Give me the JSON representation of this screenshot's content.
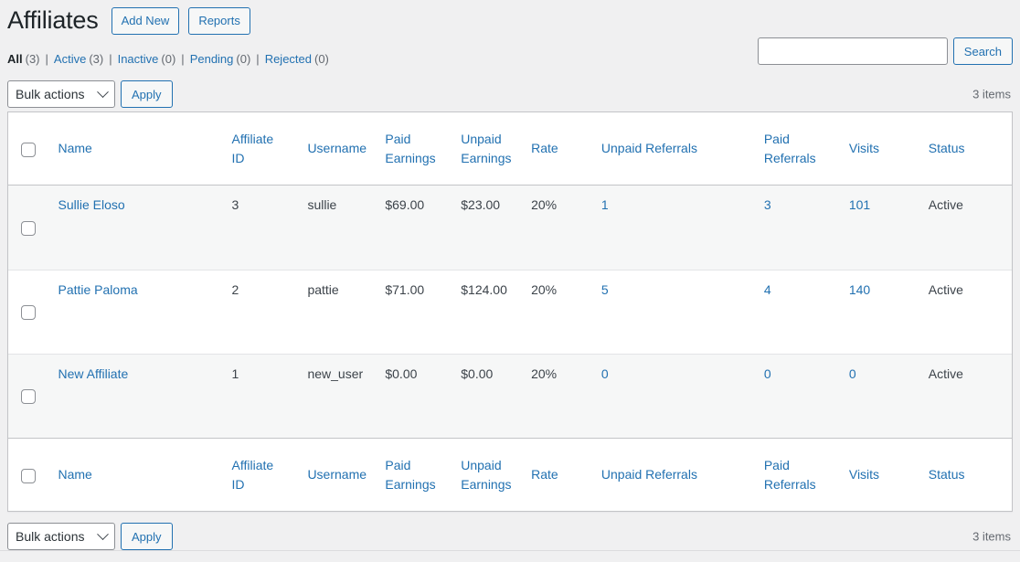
{
  "header": {
    "title": "Affiliates",
    "actions": [
      {
        "label": "Add New",
        "name": "add-new-button"
      },
      {
        "label": "Reports",
        "name": "reports-button"
      }
    ]
  },
  "filters": [
    {
      "label": "All",
      "count": "(3)",
      "current": true
    },
    {
      "label": "Active",
      "count": "(3)",
      "current": false
    },
    {
      "label": "Inactive",
      "count": "(0)",
      "current": false
    },
    {
      "label": "Pending",
      "count": "(0)",
      "current": false
    },
    {
      "label": "Rejected",
      "count": "(0)",
      "current": false
    }
  ],
  "separator": "|",
  "search": {
    "value": "",
    "placeholder": "",
    "submit_label": "Search"
  },
  "tablenav_top": {
    "bulk_label": "Bulk actions",
    "apply_label": "Apply",
    "displaying_num": "3 items"
  },
  "tablenav_bottom": {
    "bulk_label": "Bulk actions",
    "apply_label": "Apply",
    "displaying_num": "3 items"
  },
  "table": {
    "columns": [
      {
        "key": "name",
        "label": "Name"
      },
      {
        "key": "affid",
        "label": "Affiliate ID"
      },
      {
        "key": "username",
        "label": "Username"
      },
      {
        "key": "paid",
        "label": "Paid Earnings"
      },
      {
        "key": "unpaid",
        "label": "Unpaid Earnings"
      },
      {
        "key": "rate",
        "label": "Rate"
      },
      {
        "key": "unpref",
        "label": "Unpaid Referrals"
      },
      {
        "key": "paidref",
        "label": "Paid Referrals"
      },
      {
        "key": "visits",
        "label": "Visits"
      },
      {
        "key": "status",
        "label": "Status"
      }
    ],
    "rows": [
      {
        "name": "Sullie Eloso",
        "affid": "3",
        "username": "sullie",
        "paid": "$69.00",
        "unpaid": "$23.00",
        "rate": "20%",
        "unpref": "1",
        "paidref": "3",
        "visits": "101",
        "status": "Active"
      },
      {
        "name": "Pattie Paloma",
        "affid": "2",
        "username": "pattie",
        "paid": "$71.00",
        "unpaid": "$124.00",
        "rate": "20%",
        "unpref": "5",
        "paidref": "4",
        "visits": "140",
        "status": "Active"
      },
      {
        "name": "New Affiliate",
        "affid": "1",
        "username": "new_user",
        "paid": "$0.00",
        "unpaid": "$0.00",
        "rate": "20%",
        "unpref": "0",
        "paidref": "0",
        "visits": "0",
        "status": "Active"
      }
    ]
  },
  "colors": {
    "link": "#2271b1",
    "text": "#3c434a",
    "title": "#1d2327",
    "page_bg": "#f0f0f1",
    "row_alt_bg": "#f6f7f7",
    "border": "#c3c4c7"
  }
}
